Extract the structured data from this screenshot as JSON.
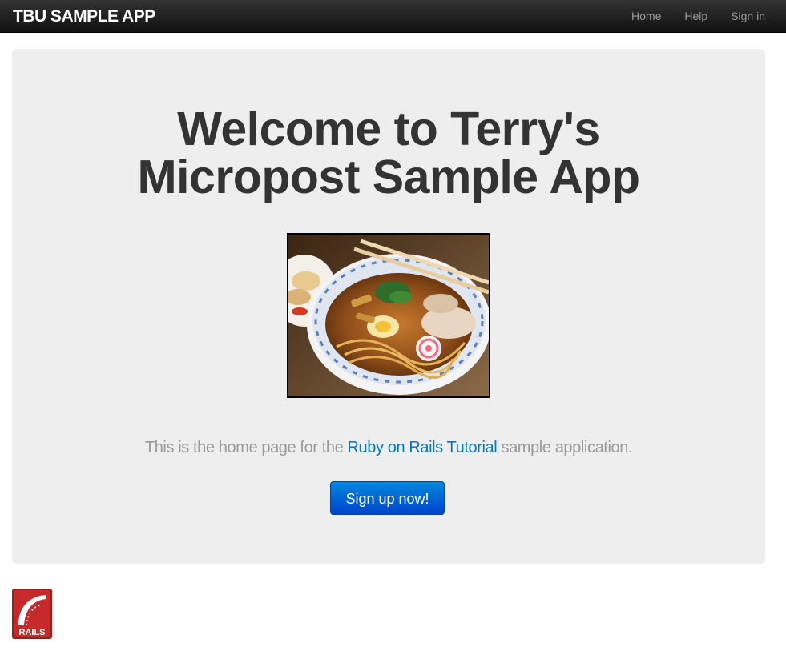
{
  "navbar": {
    "brand": "TBU SAMPLE APP",
    "links": [
      "Home",
      "Help",
      "Sign in"
    ]
  },
  "hero": {
    "title_line1": "Welcome to Terry's",
    "title_line2": "Micropost Sample App",
    "image_alt": "ramen bowl",
    "subtitle_before": "This is the home page for the ",
    "subtitle_link": "Ruby on Rails Tutorial",
    "subtitle_after": " sample application.",
    "signup_label": "Sign up now!"
  },
  "footer": {
    "logo_text": "RAILS"
  },
  "colors": {
    "navbar_bg": "#222222",
    "hero_bg": "#eeeeee",
    "link": "#0077cc",
    "button": "#0066cc"
  }
}
